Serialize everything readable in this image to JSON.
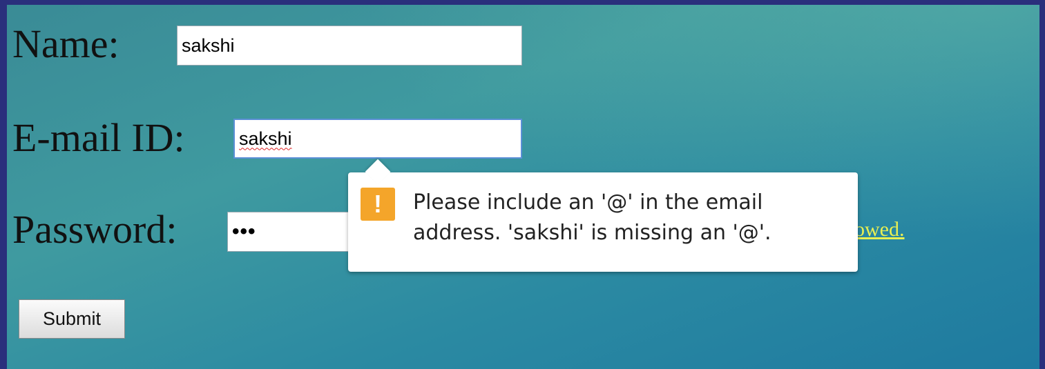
{
  "form": {
    "name_label": "Name:",
    "name_value": "sakshi",
    "email_label": "E-mail ID:",
    "email_value": "sakshi",
    "password_label": "Password:",
    "password_value": "•••",
    "note_partial": "owed.",
    "submit_label": "Submit"
  },
  "validation_tooltip": {
    "icon": "warning-icon",
    "line1": "Please include an '@' in the email",
    "line2": "address. 'sakshi' is missing an '@'."
  },
  "colors": {
    "background": "#3f9aa0",
    "note_text": "#e8ef52",
    "warning_icon": "#f4a52a",
    "focus_border": "#5b8fd6"
  }
}
